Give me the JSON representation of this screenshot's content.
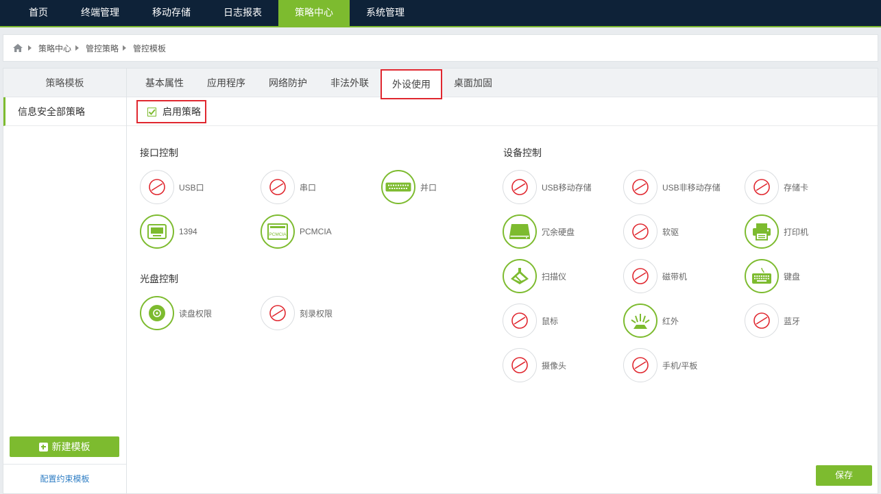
{
  "topnav": {
    "items": [
      "首页",
      "终端管理",
      "移动存储",
      "日志报表",
      "策略中心",
      "系统管理"
    ],
    "active_index": 4,
    "colors": {
      "bg": "#0e2238",
      "accent": "#7dbb2f"
    }
  },
  "breadcrumb": {
    "home_icon": "home-icon",
    "items": [
      "策略中心",
      "管控策略",
      "管控模板"
    ]
  },
  "sidebar": {
    "title": "策略模板",
    "items": [
      "信息安全部策略"
    ],
    "new_button": "新建模板",
    "config_link": "配置约束模板"
  },
  "tabs": {
    "items": [
      "基本属性",
      "应用程序",
      "网络防护",
      "非法外联",
      "外设使用",
      "桌面加固"
    ],
    "active_index": 4
  },
  "enable": {
    "label": "启用策略",
    "checked": true
  },
  "interface_control": {
    "title": "接口控制",
    "items": [
      {
        "label": "USB口",
        "state": "disabled",
        "icon": "forbidden-icon"
      },
      {
        "label": "串口",
        "state": "disabled",
        "icon": "forbidden-icon"
      },
      {
        "label": "并口",
        "state": "enabled",
        "icon": "parallel-port-icon"
      },
      {
        "label": "1394",
        "state": "enabled",
        "icon": "firewire-icon"
      },
      {
        "label": "PCMCIA",
        "state": "enabled",
        "icon": "pcmcia-icon",
        "icon_text": "PCMCIA"
      }
    ]
  },
  "disc_control": {
    "title": "光盘控制",
    "items": [
      {
        "label": "读盘权限",
        "state": "enabled",
        "icon": "disc-icon"
      },
      {
        "label": "刻录权限",
        "state": "disabled",
        "icon": "forbidden-icon"
      }
    ]
  },
  "device_control": {
    "title": "设备控制",
    "items": [
      {
        "label": "USB移动存储",
        "state": "disabled",
        "icon": "forbidden-icon"
      },
      {
        "label": "USB非移动存储",
        "state": "disabled",
        "icon": "forbidden-icon"
      },
      {
        "label": "存储卡",
        "state": "disabled",
        "icon": "forbidden-icon"
      },
      {
        "label": "冗余硬盘",
        "state": "enabled",
        "icon": "hard-disk-icon"
      },
      {
        "label": "软驱",
        "state": "disabled",
        "icon": "forbidden-icon"
      },
      {
        "label": "打印机",
        "state": "enabled",
        "icon": "printer-icon"
      },
      {
        "label": "扫描仪",
        "state": "enabled",
        "icon": "scanner-icon"
      },
      {
        "label": "磁带机",
        "state": "disabled",
        "icon": "forbidden-icon"
      },
      {
        "label": "键盘",
        "state": "enabled",
        "icon": "keyboard-icon"
      },
      {
        "label": "鼠标",
        "state": "disabled",
        "icon": "forbidden-icon"
      },
      {
        "label": "红外",
        "state": "enabled",
        "icon": "infrared-icon"
      },
      {
        "label": "蓝牙",
        "state": "disabled",
        "icon": "forbidden-icon"
      },
      {
        "label": "摄像头",
        "state": "disabled",
        "icon": "forbidden-icon"
      },
      {
        "label": "手机/平板",
        "state": "disabled",
        "icon": "forbidden-icon"
      }
    ]
  },
  "save_button": "保存",
  "colors": {
    "green": "#7dbb2f",
    "forbidden_red": "#e0262e",
    "highlight_red": "#e0262e"
  }
}
